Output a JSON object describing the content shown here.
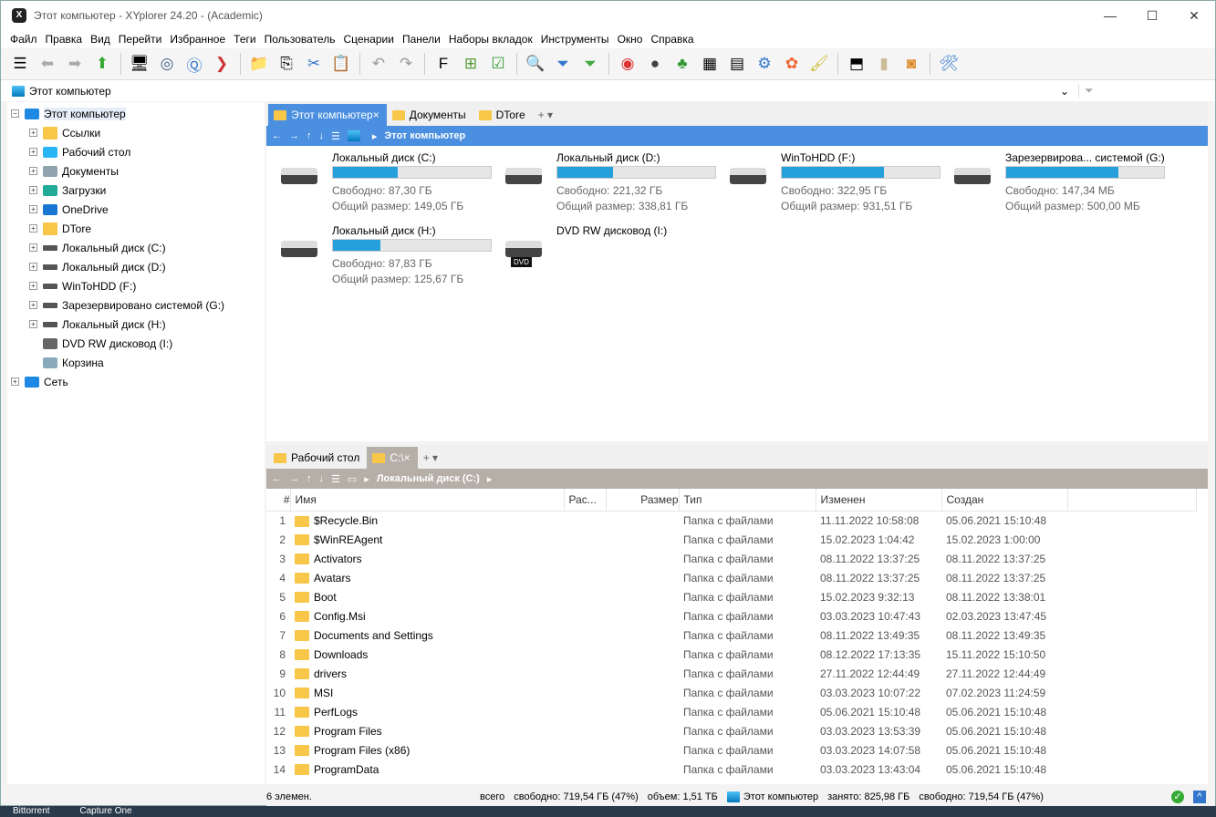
{
  "window": {
    "title": "Этот компьютер - XYplorer 24.20 - (Academic)",
    "logo": "X"
  },
  "menu": [
    "Файл",
    "Правка",
    "Вид",
    "Перейти",
    "Избранное",
    "Теги",
    "Пользователь",
    "Сценарии",
    "Панели",
    "Наборы вкладок",
    "Инструменты",
    "Окно",
    "Справка"
  ],
  "address": "Этот компьютер",
  "tree": [
    {
      "label": "Этот компьютер",
      "level": 0,
      "exp": "−",
      "icon": "pc"
    },
    {
      "label": "Ссылки",
      "level": 1,
      "exp": "+",
      "icon": "folder"
    },
    {
      "label": "Рабочий стол",
      "level": 1,
      "exp": "+",
      "icon": "desktop"
    },
    {
      "label": "Документы",
      "level": 1,
      "exp": "+",
      "icon": "docs"
    },
    {
      "label": "Загрузки",
      "level": 1,
      "exp": "+",
      "icon": "download"
    },
    {
      "label": "OneDrive",
      "level": 1,
      "exp": "+",
      "icon": "cloud"
    },
    {
      "label": "DTore",
      "level": 1,
      "exp": "+",
      "icon": "folder"
    },
    {
      "label": "Локальный диск (C:)",
      "level": 1,
      "exp": "+",
      "icon": "drive"
    },
    {
      "label": "Локальный диск (D:)",
      "level": 1,
      "exp": "+",
      "icon": "drive"
    },
    {
      "label": "WinToHDD (F:)",
      "level": 1,
      "exp": "+",
      "icon": "drive"
    },
    {
      "label": "Зарезервировано системой (G:)",
      "level": 1,
      "exp": "+",
      "icon": "drive"
    },
    {
      "label": "Локальный диск (H:)",
      "level": 1,
      "exp": "+",
      "icon": "drive"
    },
    {
      "label": "DVD RW дисковод (I:)",
      "level": 1,
      "exp": "",
      "icon": "dvd"
    },
    {
      "label": "Корзина",
      "level": 1,
      "exp": "",
      "icon": "bin"
    },
    {
      "label": "Сеть",
      "level": 0,
      "exp": "+",
      "icon": "net"
    }
  ],
  "top_pane": {
    "tabs": [
      "Этот компьютер",
      "Документы",
      "DTore"
    ],
    "path": "Этот компьютер",
    "drives": [
      {
        "name": "Локальный диск (C:)",
        "free": "Свободно: 87,30 ГБ",
        "total": "Общий размер: 149,05 ГБ",
        "used_pct": 41
      },
      {
        "name": "Локальный диск (D:)",
        "free": "Свободно: 221,32 ГБ",
        "total": "Общий размер: 338,81 ГБ",
        "used_pct": 35
      },
      {
        "name": "WinToHDD (F:)",
        "free": "Свободно: 322,95 ГБ",
        "total": "Общий размер: 931,51 ГБ",
        "used_pct": 65
      },
      {
        "name": "Зарезервирова... системой (G:)",
        "free": "Свободно: 147,34 МБ",
        "total": "Общий размер: 500,00 МБ",
        "used_pct": 71
      },
      {
        "name": "Локальный диск (H:)",
        "free": "Свободно: 87,83 ГБ",
        "total": "Общий размер: 125,67 ГБ",
        "used_pct": 30
      },
      {
        "name": "DVD RW дисковод (I:)",
        "dvd_label": "DVD"
      }
    ]
  },
  "bottom_pane": {
    "tabs": [
      "Рабочий стол",
      "C:\\"
    ],
    "path": "Локальный диск (C:)",
    "columns": [
      "#",
      "Имя",
      "Рас...",
      "Размер",
      "Тип",
      "Изменен",
      "Создан"
    ],
    "rows": [
      [
        "1",
        "$Recycle.Bin",
        "Папка с файлами",
        "11.11.2022 10:58:08",
        "05.06.2021 15:10:48"
      ],
      [
        "2",
        "$WinREAgent",
        "Папка с файлами",
        "15.02.2023 1:04:42",
        "15.02.2023 1:00:00"
      ],
      [
        "3",
        "Activators",
        "Папка с файлами",
        "08.11.2022 13:37:25",
        "08.11.2022 13:37:25"
      ],
      [
        "4",
        "Avatars",
        "Папка с файлами",
        "08.11.2022 13:37:25",
        "08.11.2022 13:37:25"
      ],
      [
        "5",
        "Boot",
        "Папка с файлами",
        "15.02.2023 9:32:13",
        "08.11.2022 13:38:01"
      ],
      [
        "6",
        "Config.Msi",
        "Папка с файлами",
        "03.03.2023 10:47:43",
        "02.03.2023 13:47:45"
      ],
      [
        "7",
        "Documents and Settings",
        "Папка с файлами",
        "08.11.2022 13:49:35",
        "08.11.2022 13:49:35"
      ],
      [
        "8",
        "Downloads",
        "Папка с файлами",
        "08.12.2022 17:13:35",
        "15.11.2022 15:10:50"
      ],
      [
        "9",
        "drivers",
        "Папка с файлами",
        "27.11.2022 12:44:49",
        "27.11.2022 12:44:49"
      ],
      [
        "10",
        "MSI",
        "Папка с файлами",
        "03.03.2023 10:07:22",
        "07.02.2023 11:24:59"
      ],
      [
        "11",
        "PerfLogs",
        "Папка с файлами",
        "05.06.2021 15:10:48",
        "05.06.2021 15:10:48"
      ],
      [
        "12",
        "Program Files",
        "Папка с файлами",
        "03.03.2023 13:53:39",
        "05.06.2021 15:10:48"
      ],
      [
        "13",
        "Program Files (x86)",
        "Папка с файлами",
        "03.03.2023 14:07:58",
        "05.06.2021 15:10:48"
      ],
      [
        "14",
        "ProgramData",
        "Папка с файлами",
        "03.03.2023 13:43:04",
        "05.06.2021 15:10:48"
      ]
    ]
  },
  "status": {
    "items": "6 элемен.",
    "total": "всего",
    "free": "свободно: 719,54 ГБ (47%)",
    "volume": "объем: 1,51 ТБ",
    "location": "Этот компьютер",
    "used": "занято: 825,98 ГБ",
    "free2": "свободно: 719,54 ГБ (47%)"
  },
  "taskbar": [
    "Bittorrent",
    "Capture One"
  ]
}
